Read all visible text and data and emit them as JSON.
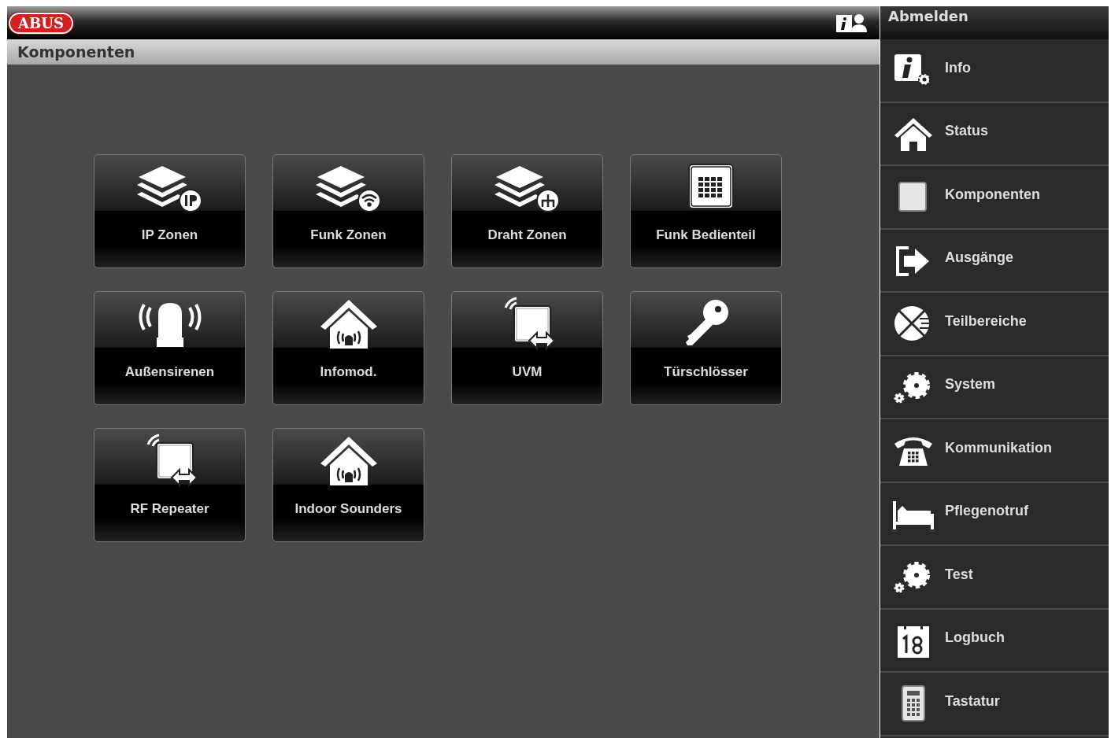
{
  "header": {
    "logo": "ABUS",
    "logout": "Abmelden"
  },
  "page_title": "Komponenten",
  "tiles": [
    {
      "label": "IP Zonen",
      "kind": "layers-ip"
    },
    {
      "label": "Funk Zonen",
      "kind": "layers-wifi"
    },
    {
      "label": "Draht Zonen",
      "kind": "layers-tree"
    },
    {
      "label": "Funk Bedienteil",
      "kind": "keypad"
    },
    {
      "label": "Außensirenen",
      "kind": "siren"
    },
    {
      "label": "Infomod.",
      "kind": "house"
    },
    {
      "label": "UVM",
      "kind": "repeater"
    },
    {
      "label": "Türschlösser",
      "kind": "key"
    },
    {
      "label": "RF Repeater",
      "kind": "repeater"
    },
    {
      "label": "Indoor Sounders",
      "kind": "house"
    }
  ],
  "sidebar": {
    "items": [
      {
        "label": "Info",
        "kind": "info"
      },
      {
        "label": "Status",
        "kind": "home"
      },
      {
        "label": "Komponenten",
        "kind": "square"
      },
      {
        "label": "Ausgänge",
        "kind": "exit"
      },
      {
        "label": "Teilbereiche",
        "kind": "pie"
      },
      {
        "label": "System",
        "kind": "gears"
      },
      {
        "label": "Kommunikation",
        "kind": "phone"
      },
      {
        "label": "Pflegenotruf",
        "kind": "bed"
      },
      {
        "label": "Test",
        "kind": "gears"
      },
      {
        "label": "Logbuch",
        "kind": "calendar"
      },
      {
        "label": "Tastatur",
        "kind": "keyboard"
      }
    ]
  }
}
